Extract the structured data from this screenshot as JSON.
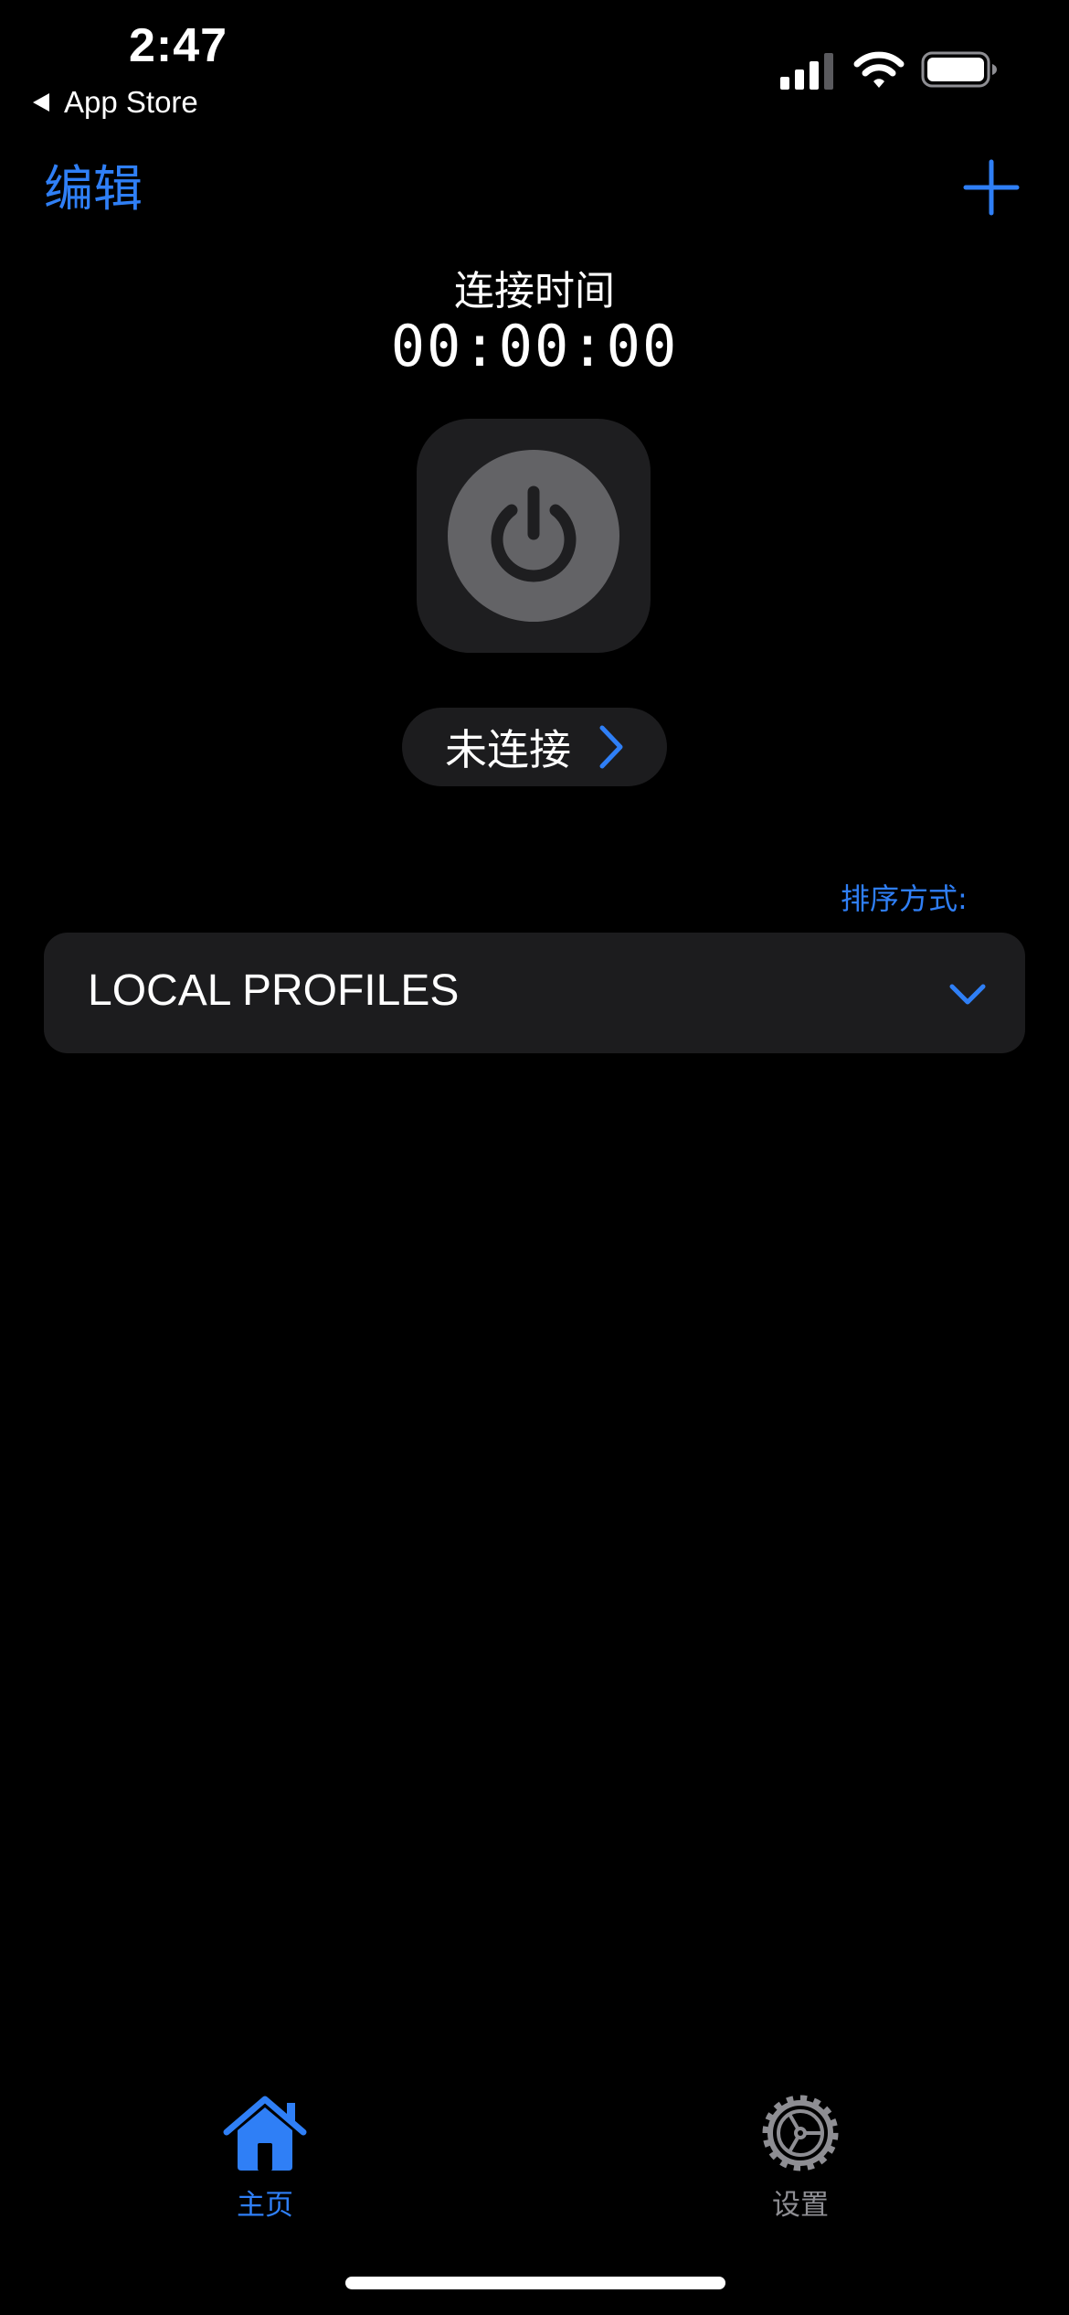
{
  "status_bar": {
    "time": "2:47",
    "back_label": "App Store",
    "icons": [
      "cellular-signal-icon",
      "wifi-icon",
      "battery-icon"
    ]
  },
  "nav": {
    "edit_label": "编辑",
    "add_icon": "plus-icon"
  },
  "connection": {
    "time_label": "连接时间",
    "time_value": "00:00:00",
    "power_icon": "power-icon",
    "status_label": "未连接",
    "status_icon": "chevron-right-icon"
  },
  "profiles": {
    "sort_label": "排序方式:",
    "group_title": "LOCAL PROFILES",
    "group_icon": "chevron-down-icon"
  },
  "tab_bar": {
    "tabs": [
      {
        "label": "主页",
        "icon": "house-icon",
        "selected": true
      },
      {
        "label": "设置",
        "icon": "gear-icon",
        "selected": false
      }
    ]
  },
  "colors": {
    "accent": "#2f7ff6",
    "background": "#000000",
    "card": "#1c1c1e",
    "power_tile": "#1e1e20",
    "power_circle": "#636366",
    "inactive": "#8e8e93"
  }
}
